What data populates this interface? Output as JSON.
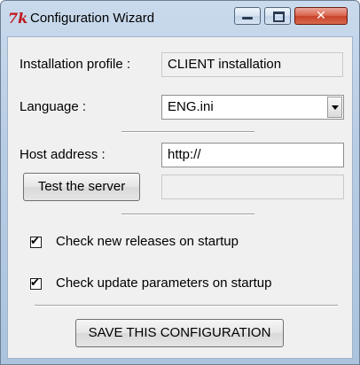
{
  "window": {
    "title": "Configuration Wizard",
    "icon": "tk-feather-icon",
    "controls": [
      "minimize",
      "maximize",
      "close"
    ],
    "close_glyph": "✕"
  },
  "form": {
    "profile_label": "Installation profile :",
    "profile_value": "CLIENT installation",
    "language_label": "Language :",
    "language_value": "ENG.ini",
    "host_label": "Host address :",
    "host_value": "http://",
    "test_button": "Test the server",
    "server_result": ""
  },
  "options": [
    {
      "label": "Check new releases on startup",
      "checked": true
    },
    {
      "label": "Check update parameters on startup",
      "checked": true
    }
  ],
  "save_button": "SAVE THIS CONFIGURATION",
  "colors": {
    "titlebar": "#b7cde4",
    "client": "#f0f0f0",
    "close_button": "#c8412a",
    "app_icon": "#c0141a"
  }
}
